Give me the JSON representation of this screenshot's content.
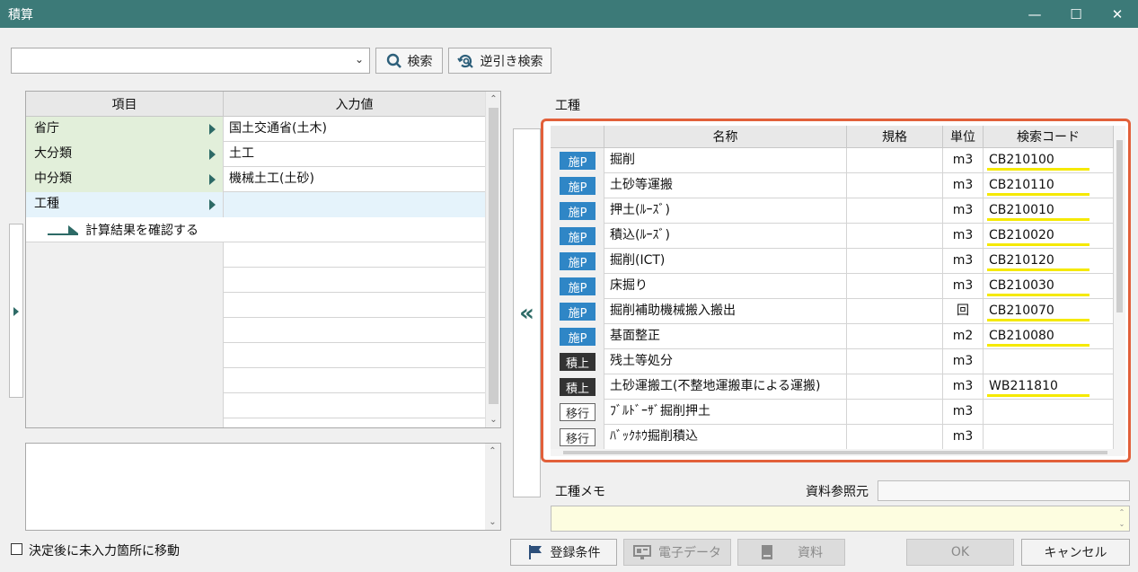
{
  "window": {
    "title": "積算",
    "minimize": "—",
    "maximize": "☐",
    "close": "✕"
  },
  "search": {
    "combo_value": "",
    "search_label": "検索",
    "reverse_search_label": "逆引き検索"
  },
  "left_grid": {
    "headers": {
      "item": "項目",
      "value": "入力値"
    },
    "rows": [
      {
        "item": "省庁",
        "value": "国土交通省(土木)"
      },
      {
        "item": "大分類",
        "value": "土工"
      },
      {
        "item": "中分類",
        "value": "機械土工(土砂)"
      },
      {
        "item": "工種",
        "value": ""
      }
    ],
    "confirm_link": "計算結果を確認する"
  },
  "right_panel": {
    "section_label": "工種",
    "headers": {
      "name": "名称",
      "spec": "規格",
      "unit": "単位",
      "code": "検索コード"
    },
    "rows": [
      {
        "badge": "施P",
        "badge_type": "se",
        "name": "掘削",
        "spec": "",
        "unit": "m3",
        "code": "CB210100"
      },
      {
        "badge": "施P",
        "badge_type": "se",
        "name": "土砂等運搬",
        "spec": "",
        "unit": "m3",
        "code": "CB210110"
      },
      {
        "badge": "施P",
        "badge_type": "se",
        "name": "押土(ﾙｰｽﾞ)",
        "spec": "",
        "unit": "m3",
        "code": "CB210010"
      },
      {
        "badge": "施P",
        "badge_type": "se",
        "name": "積込(ﾙｰｽﾞ)",
        "spec": "",
        "unit": "m3",
        "code": "CB210020"
      },
      {
        "badge": "施P",
        "badge_type": "se",
        "name": "掘削(ICT)",
        "spec": "",
        "unit": "m3",
        "code": "CB210120"
      },
      {
        "badge": "施P",
        "badge_type": "se",
        "name": "床掘り",
        "spec": "",
        "unit": "m3",
        "code": "CB210030"
      },
      {
        "badge": "施P",
        "badge_type": "se",
        "name": "掘削補助機械搬入搬出",
        "spec": "",
        "unit": "回",
        "code": "CB210070"
      },
      {
        "badge": "施P",
        "badge_type": "se",
        "name": "基面整正",
        "spec": "",
        "unit": "m2",
        "code": "CB210080"
      },
      {
        "badge": "積上",
        "badge_type": "ts",
        "name": "残土等処分",
        "spec": "",
        "unit": "m3",
        "code": ""
      },
      {
        "badge": "積上",
        "badge_type": "ts",
        "name": "土砂運搬工(不整地運搬車による運搬)",
        "spec": "",
        "unit": "m3",
        "code": "WB211810"
      },
      {
        "badge": "移行",
        "badge_type": "ik",
        "name": "ﾌﾞﾙﾄﾞｰｻﾞ掘削押土",
        "spec": "",
        "unit": "m3",
        "code": ""
      },
      {
        "badge": "移行",
        "badge_type": "ik",
        "name": "ﾊﾞｯｸﾎｳ掘削積込",
        "spec": "",
        "unit": "m3",
        "code": ""
      }
    ],
    "memo_label": "工種メモ",
    "ref_label": "資料参照元",
    "ref_value": "",
    "memo_value": ""
  },
  "footer": {
    "checkbox_label": "決定後に未入力箇所に移動",
    "checkbox_checked": false,
    "register_label": "登録条件",
    "edata_label": "電子データ",
    "docs_label": "資料",
    "ok_label": "OK",
    "cancel_label": "キャンセル"
  },
  "colors": {
    "titlebar": "#3c7a78",
    "highlight_frame": "#e2603a",
    "badge_se": "#2f86c6",
    "badge_ts": "#333333",
    "code_underline": "#f5e900",
    "category_cell": "#e2efda"
  }
}
